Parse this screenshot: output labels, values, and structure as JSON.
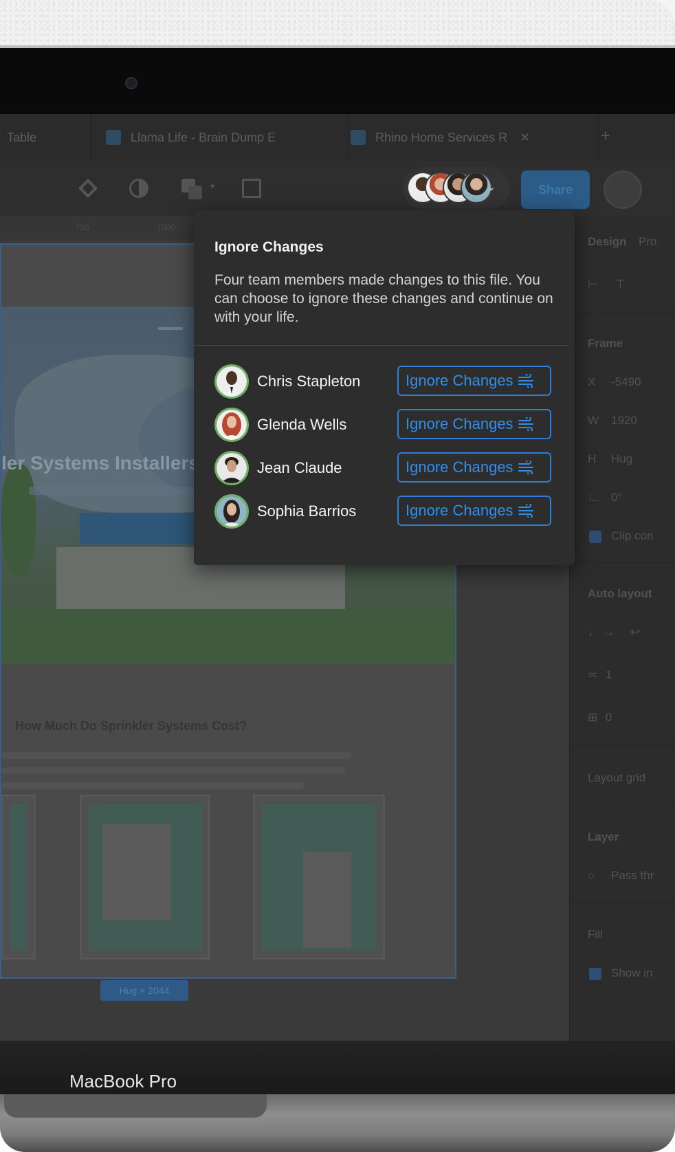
{
  "tabs": [
    {
      "label": "Table",
      "closable": false
    },
    {
      "label": "Llama Life - Brain Dump E",
      "closable": false
    },
    {
      "label": "Rhino Home Services R",
      "closable": true
    }
  ],
  "toolbar": {
    "share_label": "Share",
    "icons": [
      "component-icon",
      "contrast-icon",
      "boolean-icon",
      "frame-icon"
    ]
  },
  "canvas": {
    "ruler_labels": [
      "750",
      "1000"
    ],
    "hero_headline": "ler Systems Installers",
    "section_title": "How Much Do Sprinkler Systems Cost?",
    "size_tag": "Hug × 2044"
  },
  "right_panel": {
    "design_tab": "Design",
    "prototype_tab": "Pro",
    "frame_label": "Frame",
    "x_label": "X",
    "x_value": "-5490",
    "w_label": "W",
    "w_value": "1920",
    "h_label": "H",
    "h_value": "Hug",
    "rotation_value": "0°",
    "clip_label": "Clip con",
    "auto_layout_label": "Auto layout",
    "gap_value": "1",
    "padding_value": "0",
    "layout_grid_label": "Layout grid",
    "layer_label": "Layer",
    "pass_label": "Pass thr",
    "fill_label": "Fill",
    "show_label": "Show in"
  },
  "popover": {
    "title": "Ignore Changes",
    "description": "Four team members made changes to this file. You can choose to ignore these changes and continue on with your life.",
    "members": [
      {
        "name": "Chris Stapleton",
        "button": "Ignore Changes"
      },
      {
        "name": "Glenda Wells",
        "button": "Ignore Changes"
      },
      {
        "name": "Jean Claude",
        "button": "Ignore Changes"
      },
      {
        "name": "Sophia Barrios",
        "button": "Ignore Changes"
      }
    ],
    "accent_color": "#2f8fea",
    "avatar_ring_color": "#6fb065"
  },
  "device": {
    "brand": "MacBook Pro"
  }
}
